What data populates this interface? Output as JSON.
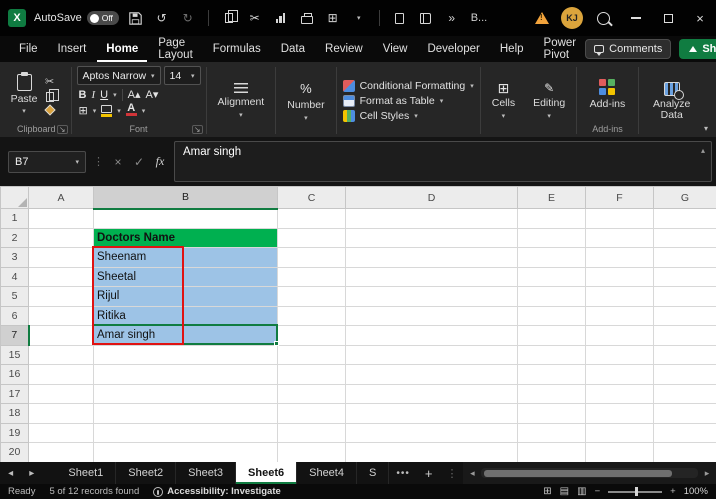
{
  "colors": {
    "accent": "#107C41"
  },
  "icons": {
    "excel_logo": "X",
    "undo": "↺",
    "redo": "↻",
    "cut": "✂",
    "dropdown": "▾",
    "collapse": "▴",
    "launcher": "↘",
    "more_chevron": "»",
    "vertical_dots": "⋮",
    "cancel": "×",
    "enter": "✓",
    "nav_left": "◂",
    "nav_right": "▸",
    "close": "×",
    "percent": "%",
    "borders": "⊞",
    "cells": "⊞",
    "editing": "✎",
    "table": "⊞",
    "bold": "B",
    "italic": "I",
    "underline": "U",
    "font_grow": "A▴",
    "font_shrink": "A▾",
    "font_color_letter": "A",
    "view_normal": "⊞",
    "view_layout": "▤",
    "view_break": "▥",
    "minus": "−",
    "plus": "+"
  },
  "titlebar": {
    "autosave_label": "AutoSave",
    "autosave_state": "Off",
    "workbook_title": "B...",
    "avatar_initials": "KJ"
  },
  "menu": {
    "tabs": [
      "File",
      "Insert",
      "Home",
      "Page Layout",
      "Formulas",
      "Data",
      "Review",
      "View",
      "Developer",
      "Help",
      "Power Pivot"
    ],
    "active": "Home",
    "comments_label": "Comments",
    "share_label": "Share"
  },
  "ribbon": {
    "paste_label": "Paste",
    "font_name": "Aptos Narrow",
    "font_size": "14",
    "alignment_label": "Alignment",
    "number_label": "Number",
    "style_buttons": [
      "Conditional Formatting",
      "Format as Table",
      "Cell Styles"
    ],
    "cells_label": "Cells",
    "editing_label": "Editing",
    "addins_button_label": "Add-ins",
    "analyze_label": "Analyze Data",
    "group_labels": {
      "clipboard": "Clipboard",
      "font": "Font",
      "addins": "Add-ins"
    }
  },
  "formula_bar": {
    "name_box": "B7",
    "fx_label": "fx",
    "content": "Amar singh"
  },
  "grid": {
    "columns": [
      "A",
      "B",
      "C",
      "D",
      "E",
      "F",
      "G"
    ],
    "rows": [
      "1",
      "2",
      "3",
      "4",
      "5",
      "6",
      "7",
      "15",
      "16",
      "17",
      "18",
      "19",
      "20"
    ],
    "cells": [
      {
        "col": "B",
        "row": "2",
        "text": "Doctors Name",
        "type": "header"
      },
      {
        "col": "B",
        "row": "3",
        "text": "Sheenam",
        "type": "data"
      },
      {
        "col": "B",
        "row": "4",
        "text": "Sheetal",
        "type": "data"
      },
      {
        "col": "B",
        "row": "5",
        "text": "Rijul",
        "type": "data"
      },
      {
        "col": "B",
        "row": "6",
        "text": "Ritika",
        "type": "data"
      },
      {
        "col": "B",
        "row": "7",
        "text": "Amar singh",
        "type": "data"
      }
    ],
    "selection": {
      "column": "B",
      "row": "7",
      "active_cell": "B7"
    },
    "colors": {
      "header_fill": "#00B050",
      "data_fill": "#9DC3E6",
      "selection": "#107C41",
      "annotation": "#E01212"
    }
  },
  "sheet_bar": {
    "tabs": [
      "Sheet1",
      "Sheet2",
      "Sheet3",
      "Sheet6",
      "Sheet4",
      "S"
    ],
    "active": "Sheet6",
    "overflow": "•••",
    "new_sheet": "+"
  },
  "status_bar": {
    "ready": "Ready",
    "records": "5 of 12 records found",
    "accessibility": "Accessibility: Investigate",
    "zoom": "100%"
  }
}
